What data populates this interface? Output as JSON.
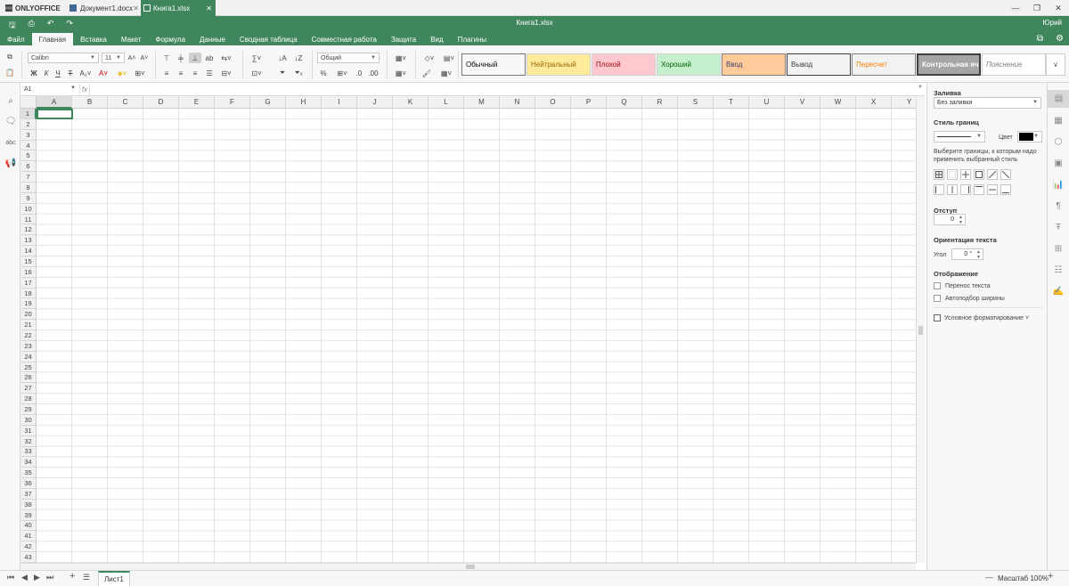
{
  "app": {
    "brand": "ONLYOFFICE",
    "tabs": [
      {
        "label": "Документ1.docx",
        "close": "✕"
      },
      {
        "label": "Книга1.xlsx",
        "close": "✕"
      }
    ],
    "window_title": "Книга1.xlsx",
    "user": "Юрий"
  },
  "menu": [
    "Файл",
    "Главная",
    "Вставка",
    "Макет",
    "Формула",
    "Данные",
    "Сводная таблица",
    "Совместная работа",
    "Защита",
    "Вид",
    "Плагины"
  ],
  "toolbar": {
    "font_name": "Calibri",
    "font_size": "11",
    "number_format": "Общий",
    "bold": "Ж",
    "italic": "К",
    "underline": "Ч",
    "strike": "Т",
    "font_inc": "A˄",
    "font_dec": "A˅",
    "sum": "∑",
    "percent": "%",
    "styles": [
      {
        "label": "Обычный",
        "bg": "#ffffff",
        "color": "#000000"
      },
      {
        "label": "Нейтральный",
        "bg": "#ffeb9c",
        "color": "#9c6500"
      },
      {
        "label": "Плохой",
        "bg": "#ffc7ce",
        "color": "#9c0006"
      },
      {
        "label": "Хороший",
        "bg": "#c6efce",
        "color": "#006100"
      },
      {
        "label": "Ввод",
        "bg": "#ffcc99",
        "color": "#3f3f76"
      },
      {
        "label": "Вывод",
        "bg": "#f2f2f2",
        "color": "#3f3f3f"
      },
      {
        "label": "Пересчет",
        "bg": "#f2f2f2",
        "color": "#fa7d00"
      },
      {
        "label": "Контрольная ячейка",
        "bg": "#a5a5a5",
        "color": "#ffffff"
      },
      {
        "label": "Пояснение",
        "bg": "#ffffff",
        "color": "#7f7f7f"
      }
    ]
  },
  "formula_bar": {
    "cell_ref": "A1",
    "fx": "fx",
    "value": ""
  },
  "grid": {
    "columns": [
      "A",
      "B",
      "C",
      "D",
      "E",
      "F",
      "G",
      "H",
      "I",
      "J",
      "K",
      "L",
      "M",
      "N",
      "O",
      "P",
      "Q",
      "R",
      "S",
      "T",
      "U",
      "V",
      "W",
      "X",
      "Y"
    ],
    "rows": [
      "1",
      "2",
      "3",
      "4",
      "5",
      "6",
      "7",
      "8",
      "9",
      "10",
      "11",
      "12",
      "13",
      "14",
      "15",
      "16",
      "17",
      "18",
      "19",
      "20",
      "21",
      "22",
      "23",
      "24",
      "25",
      "26",
      "27",
      "28",
      "29",
      "30",
      "31",
      "32",
      "33",
      "34",
      "35",
      "36",
      "37",
      "38",
      "39",
      "40",
      "41",
      "42",
      "43"
    ],
    "active_cell": "A1"
  },
  "right_panel": {
    "fill_title": "Заливка",
    "fill_value": "Без заливки",
    "border_style_title": "Стиль границ",
    "border_color_label": "Цвет",
    "border_color": "#000000",
    "border_hint": "Выберите границы, к которым надо применить выбранный стиль",
    "indent_title": "Отступ",
    "indent_value": "0",
    "orientation_title": "Ориентация текста",
    "angle_label": "Угол",
    "angle_value": "0 °",
    "display_title": "Отображение",
    "wrap_text": "Перенос текста",
    "autofit": "Автоподбор ширины",
    "cond_format": "Условное форматирование"
  },
  "status": {
    "sheet": "Лист1",
    "zoom": "Масштаб 100%",
    "zoom_minus": "—",
    "zoom_plus": "+"
  }
}
